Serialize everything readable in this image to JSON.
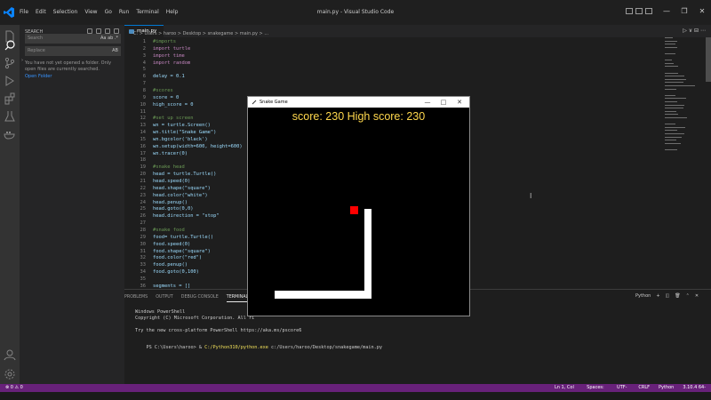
{
  "window": {
    "title": "main.py - Visual Studio Code",
    "menu": [
      "File",
      "Edit",
      "Selection",
      "View",
      "Go",
      "Run",
      "Terminal",
      "Help"
    ],
    "controls": [
      "—",
      "❐",
      "✕"
    ]
  },
  "sidebar": {
    "header": "SEARCH",
    "search_placeholder": "Search",
    "search_options": "Aa ab .*",
    "replace_placeholder": "Replace",
    "replace_options": "AB",
    "message": "You have not yet opened a folder. Only open files are currently searched.",
    "open_folder_link": "Open Folder"
  },
  "editor": {
    "tab_label": "main.py",
    "breadcrumb": "C: > Users > haroo > Desktop > snakegame > main.py > ...",
    "run_label": "▷ ∨  ⊟  ⋯",
    "lines": [
      {
        "n": "1",
        "text": "#imports",
        "kind": "c-comment"
      },
      {
        "n": "2",
        "text": "import turtle",
        "kind": "c-kw"
      },
      {
        "n": "3",
        "text": "import time",
        "kind": "c-kw"
      },
      {
        "n": "4",
        "text": "import random",
        "kind": "c-kw"
      },
      {
        "n": "5",
        "text": "",
        "kind": "c-plain"
      },
      {
        "n": "6",
        "text": "delay = 0.1",
        "kind": "c-plain"
      },
      {
        "n": "7",
        "text": "",
        "kind": "c-plain"
      },
      {
        "n": "8",
        "text": "#scores",
        "kind": "c-comment"
      },
      {
        "n": "9",
        "text": "score = 0",
        "kind": "c-plain"
      },
      {
        "n": "10",
        "text": "high_score = 0",
        "kind": "c-plain"
      },
      {
        "n": "11",
        "text": "",
        "kind": "c-plain"
      },
      {
        "n": "12",
        "text": "#set up screen",
        "kind": "c-comment"
      },
      {
        "n": "13",
        "text": "wn = turtle.Screen()",
        "kind": "c-plain"
      },
      {
        "n": "14",
        "text": "wn.title(\"Snake Game\")",
        "kind": "c-plain"
      },
      {
        "n": "15",
        "text": "wn.bgcolor('black')",
        "kind": "c-plain"
      },
      {
        "n": "16",
        "text": "wn.setup(width=600, height=600)",
        "kind": "c-plain"
      },
      {
        "n": "17",
        "text": "wn.tracer(0)",
        "kind": "c-plain"
      },
      {
        "n": "18",
        "text": "",
        "kind": "c-plain"
      },
      {
        "n": "19",
        "text": "#snake head",
        "kind": "c-comment"
      },
      {
        "n": "20",
        "text": "head = turtle.Turtle()",
        "kind": "c-plain"
      },
      {
        "n": "21",
        "text": "head.speed(0)",
        "kind": "c-plain"
      },
      {
        "n": "22",
        "text": "head.shape(\"square\")",
        "kind": "c-plain"
      },
      {
        "n": "23",
        "text": "head.color(\"white\")",
        "kind": "c-plain"
      },
      {
        "n": "24",
        "text": "head.penup()",
        "kind": "c-plain"
      },
      {
        "n": "25",
        "text": "head.goto(0,0)",
        "kind": "c-plain"
      },
      {
        "n": "26",
        "text": "head.direction = \"stop\"",
        "kind": "c-plain"
      },
      {
        "n": "27",
        "text": "",
        "kind": "c-plain"
      },
      {
        "n": "28",
        "text": "#snake food",
        "kind": "c-comment"
      },
      {
        "n": "29",
        "text": "food= turtle.Turtle()",
        "kind": "c-plain"
      },
      {
        "n": "30",
        "text": "food.speed(0)",
        "kind": "c-plain"
      },
      {
        "n": "31",
        "text": "food.shape(\"square\")",
        "kind": "c-plain"
      },
      {
        "n": "32",
        "text": "food.color(\"red\")",
        "kind": "c-plain"
      },
      {
        "n": "33",
        "text": "food.penup()",
        "kind": "c-plain"
      },
      {
        "n": "34",
        "text": "food.goto(0,100)",
        "kind": "c-plain"
      },
      {
        "n": "35",
        "text": "",
        "kind": "c-plain"
      },
      {
        "n": "36",
        "text": "segments = []",
        "kind": "c-plain"
      }
    ]
  },
  "panel": {
    "tabs": [
      "PROBLEMS",
      "OUTPUT",
      "DEBUG CONSOLE",
      "TERMINAL"
    ],
    "terminal_label": "Python",
    "terminal_lines": [
      "Windows PowerShell",
      "Copyright (C) Microsoft Corporation. All ri",
      "",
      "Try the new cross-platform PowerShell https://aka.ms/pscore6"
    ],
    "prompt": "PS C:\\Users\\haroo> & ",
    "command_exe": "C:/Python310/python.exe",
    "command_arg": " c:/Users/haroo/Desktop/snakegame/main.py"
  },
  "statusbar": {
    "left": "⊗ 0  ⚠ 0",
    "position": "Ln 1, Col 1",
    "spaces": "Spaces: 4",
    "encoding": "UTF-8",
    "eol": "CRLF",
    "language": "Python",
    "interpreter": "3.10.4 64-bit"
  },
  "game": {
    "window_title": "Snake Game",
    "score_text": "score: 230  High score: 230",
    "colors": {
      "snake": "#ffffff",
      "food": "#ff0000",
      "score": "#ffd84d"
    }
  }
}
